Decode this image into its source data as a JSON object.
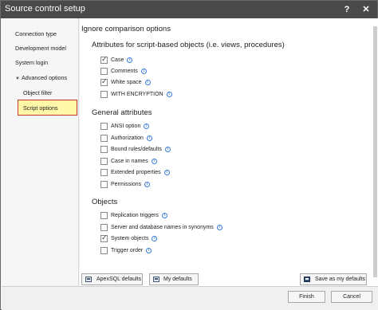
{
  "window": {
    "title": "Source control setup",
    "help_glyph": "?",
    "close_glyph": "✕"
  },
  "sidebar": {
    "items": [
      {
        "label": "Connection type"
      },
      {
        "label": "Development model"
      },
      {
        "label": "System login"
      },
      {
        "label": "Advanced options",
        "expanded": true
      },
      {
        "label": "Object filter"
      },
      {
        "label": "Script options",
        "selected": true
      }
    ],
    "expand_glyph": "▼"
  },
  "main": {
    "title": "Ignore comparison options",
    "sections": [
      {
        "title": "Attributes for script-based objects (i.e. views, procedures)",
        "options": [
          {
            "label": "Case",
            "checked": true
          },
          {
            "label": "Comments",
            "checked": false
          },
          {
            "label": "White space",
            "checked": true
          },
          {
            "label": "WITH ENCRYPTION",
            "checked": false
          }
        ]
      },
      {
        "title": "General attributes",
        "options": [
          {
            "label": "ANSI option",
            "checked": false
          },
          {
            "label": "Authorization",
            "checked": false
          },
          {
            "label": "Bound rules/defaults",
            "checked": false
          },
          {
            "label": "Case in names",
            "checked": false
          },
          {
            "label": "Extended properties",
            "checked": false
          },
          {
            "label": "Permissions",
            "checked": false
          }
        ]
      },
      {
        "title": "Objects",
        "options": [
          {
            "label": "Replication triggers",
            "checked": false
          },
          {
            "label": "Server and database names in synonyms",
            "checked": false
          },
          {
            "label": "System objects",
            "checked": true
          },
          {
            "label": "Trigger order",
            "checked": false
          }
        ]
      }
    ],
    "info_glyph": "i"
  },
  "buttons": {
    "apexsql_defaults": "ApexSQL defaults",
    "my_defaults": "My defaults",
    "save_as_my_defaults": "Save as my defaults",
    "finish": "Finish",
    "cancel": "Cancel"
  },
  "colors": {
    "titlebar": "#4a4a4a",
    "selected_bg": "#fff8a8",
    "selected_border": "#c0392b",
    "info_icon": "#3b7dd8"
  }
}
